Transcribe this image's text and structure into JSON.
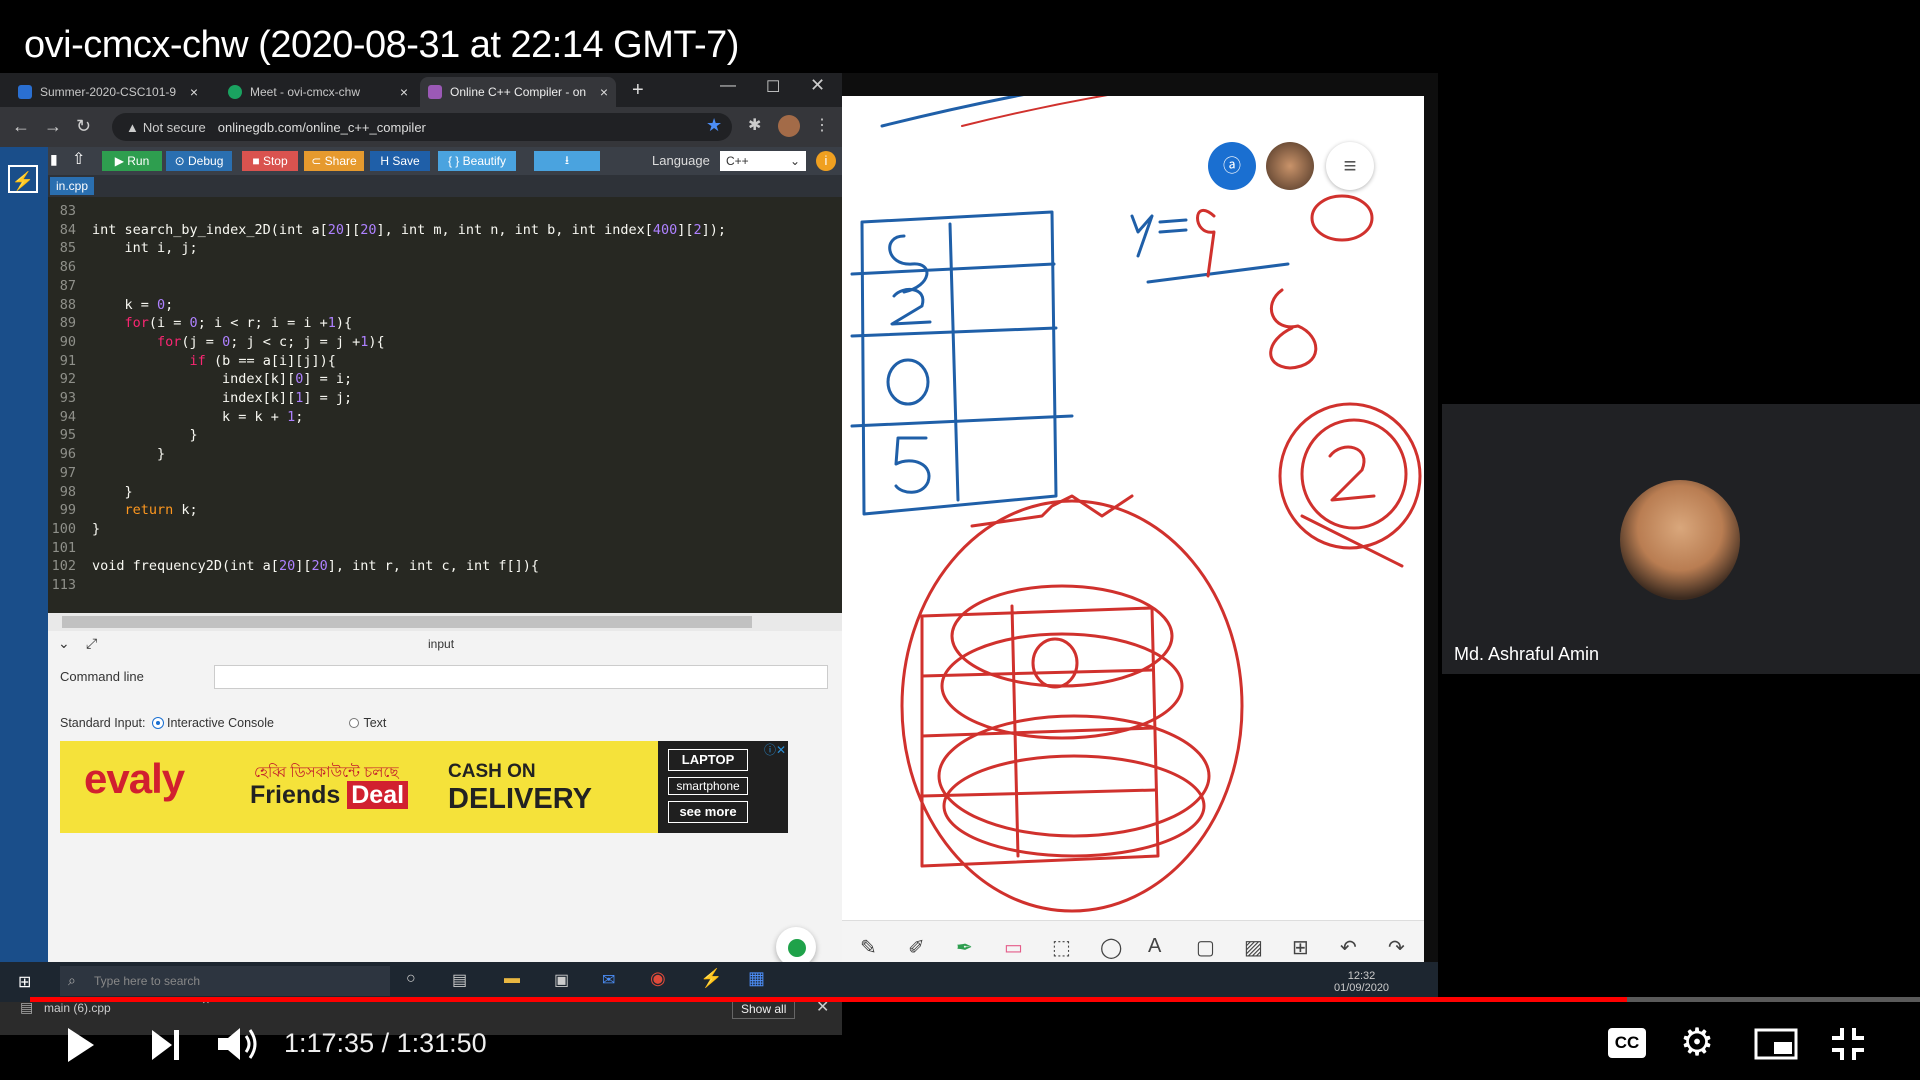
{
  "video": {
    "title": "ovi-cmcx-chw (2020-08-31 at 22:14 GMT-7)"
  },
  "browser": {
    "tabs": [
      {
        "label": "Summer-2020-CSC101-9",
        "color": "#2a6fd1"
      },
      {
        "label": "Meet - ovi-cmcx-chw",
        "color": "#1aa260"
      },
      {
        "label": "Online C++ Compiler - on",
        "color": "#9b59b6"
      }
    ],
    "new_tab": "+",
    "security": "Not secure",
    "url": "onlinegdb.com/online_c++_compiler",
    "toolbar": {
      "run": "▶ Run",
      "debug": "⊙ Debug",
      "stop": "■ Stop",
      "share": "⊂ Share",
      "save": "H Save",
      "beautify": "{ } Beautify",
      "download": "⭳",
      "language_label": "Language",
      "language_value": "C++"
    },
    "file_tab": "in.cpp",
    "io": {
      "title": "input",
      "command_line": "Command line",
      "stdin_label": "Standard Input:",
      "opt_console": "Interactive Console",
      "opt_text": "Text"
    },
    "ad": {
      "logo": "evaly",
      "bengali": "হেব্বি ডিসকাউন্টে চলছে",
      "friends": "Friends",
      "deal": "Deal",
      "cash": "CASH ON",
      "delivery": "DELIVERY",
      "laptop": "LAPTOP",
      "smartphone": "smartphone",
      "more": "see more"
    },
    "downloads": {
      "file": "main (6).cpp",
      "show_all": "Show all"
    }
  },
  "code": [
    {
      "n": "83",
      "t": ""
    },
    {
      "n": "84",
      "t": "int search_by_index_2D(int a[20][20], int m, int n, int b, int index[400][2]);"
    },
    {
      "n": "85",
      "t": "    int i, j;"
    },
    {
      "n": "86",
      "t": ""
    },
    {
      "n": "87",
      "t": ""
    },
    {
      "n": "88",
      "t": "    k = 0;"
    },
    {
      "n": "89",
      "t": "    for(i = 0; i < r; i = i +1){"
    },
    {
      "n": "90",
      "t": "        for(j = 0; j < c; j = j +1){"
    },
    {
      "n": "91",
      "t": "            if (b == a[i][j]){"
    },
    {
      "n": "92",
      "t": "                index[k][0] = i;"
    },
    {
      "n": "93",
      "t": "                index[k][1] = j;"
    },
    {
      "n": "94",
      "t": "                k = k + 1;"
    },
    {
      "n": "95",
      "t": "            }"
    },
    {
      "n": "96",
      "t": "        }"
    },
    {
      "n": "97",
      "t": ""
    },
    {
      "n": "98",
      "t": "    }"
    },
    {
      "n": "99",
      "t": "    return k;"
    },
    {
      "n": "100",
      "t": "}"
    },
    {
      "n": "101",
      "t": ""
    },
    {
      "n": "102",
      "t": "void frequency2D(int a[20][20], int r, int c, int f[]){"
    },
    {
      "n": "113",
      "t": ""
    }
  ],
  "taskbar": {
    "search_placeholder": "Type here to search",
    "time": "12:32",
    "date": "01/09/2020"
  },
  "participant": {
    "name": "Md. Ashraful Amin"
  },
  "player": {
    "time": "1:17:35 / 1:31:50",
    "progress": 0.8452,
    "cc": "CC"
  }
}
